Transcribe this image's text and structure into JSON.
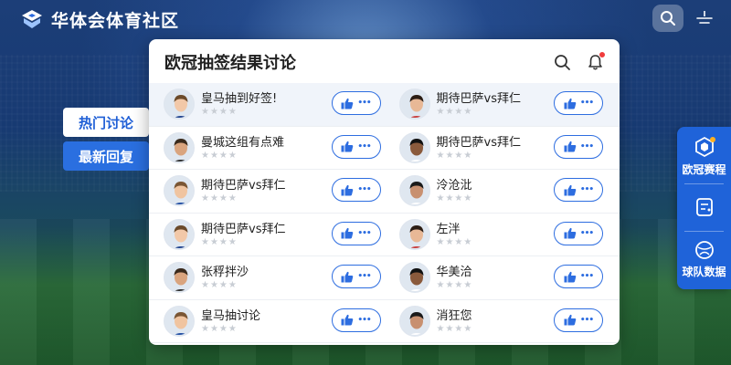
{
  "header": {
    "app_title": "华体会体育社区",
    "logo_icon": "shield-logo-icon",
    "search_icon": "search-icon",
    "menu_icon": "antenna-menu-icon"
  },
  "left_tabs": [
    {
      "label": "热门讨论",
      "active": true
    },
    {
      "label": "最新回复",
      "active": false
    }
  ],
  "panel": {
    "title": "欧冠抽签结果讨论",
    "search_icon": "search-icon",
    "bell_icon": "bell-icon",
    "has_notification": true
  },
  "posts": [
    {
      "name": "皇马抽到好签!",
      "stars": "★★★★"
    },
    {
      "name": "期待巴萨vs拜仁",
      "stars": "★★★★"
    },
    {
      "name": "曼城这组有点难",
      "stars": "★★★★"
    },
    {
      "name": "期待巴萨vs拜仁",
      "stars": "★★★★"
    },
    {
      "name": "期待巴萨vs拜仁",
      "stars": "★★★★"
    },
    {
      "name": "泠沧沘",
      "stars": "★★★★"
    },
    {
      "name": "期待巴萨vs拜仁",
      "stars": "★★★★"
    },
    {
      "name": "左泮",
      "stars": "★★★★"
    },
    {
      "name": "张稃拌沙",
      "stars": "★★★★"
    },
    {
      "name": "华美洽",
      "stars": "★★★★"
    },
    {
      "name": "皇马抽讨论",
      "stars": "★★★★"
    },
    {
      "name": "消狂您",
      "stars": "★★★★"
    }
  ],
  "like_button": {
    "icon": "thumbs-up-icon",
    "more": "•••"
  },
  "right_sidebar": [
    {
      "label": "欧冠赛程",
      "icon": "trophy-cube-icon"
    },
    {
      "label": "",
      "icon": "schedule-card-icon"
    },
    {
      "label": "球队数据",
      "icon": "team-globe-icon"
    }
  ],
  "colors": {
    "accent": "#1f63d9",
    "tab_active_text": "#1f5fd6",
    "notification": "#f03c3c"
  }
}
